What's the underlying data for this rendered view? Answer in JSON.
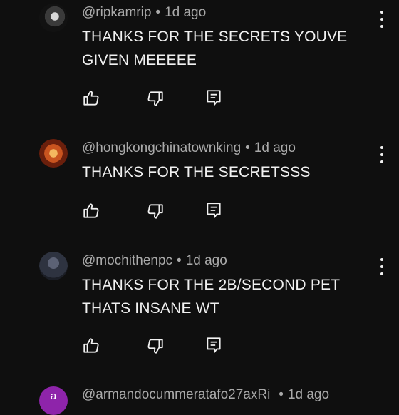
{
  "comments": [
    {
      "handle": "@ripkamrip",
      "separator": "•",
      "time": "1d ago",
      "text": "THANKS FOR THE SECRETS YOUVE GIVEN MEEEEE",
      "avatar_colors": [
        "#1c1c1c",
        "#cfcfcf"
      ]
    },
    {
      "handle": "@hongkongchinatownking",
      "separator": "•",
      "time": "1d ago",
      "text": "THANKS FOR THE SECRETSSS",
      "avatar_colors": [
        "#b24a1d",
        "#f0a24a"
      ]
    },
    {
      "handle": "@mochithenpc",
      "separator": "•",
      "time": "1d ago",
      "text": "THANKS FOR THE 2B/SECOND PET THATS INSANE WT",
      "avatar_colors": [
        "#2e3340",
        "#5c6275"
      ]
    },
    {
      "handle": "@armandocummeratafo27axRi",
      "separator": "•",
      "time": "1d ago",
      "avatar_letter": "a",
      "avatar_colors": [
        "#7b1fa2",
        "#9c27b0"
      ]
    }
  ],
  "icons": {
    "like": "thumbs-up-icon",
    "dislike": "thumbs-down-icon",
    "reply": "reply-icon",
    "more": "more-vert-icon"
  },
  "colors": {
    "background": "#0f0f0f",
    "text": "#f1f1f1",
    "meta": "#aaaaaa"
  }
}
